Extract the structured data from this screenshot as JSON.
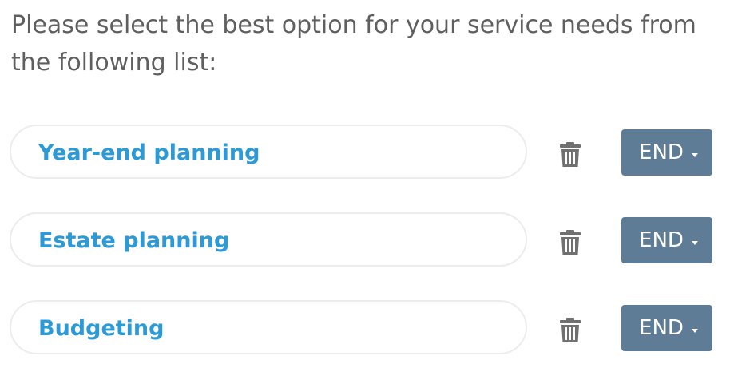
{
  "prompt": "Please select the best option for your service needs from the following list:",
  "options": [
    {
      "label": "Year-end planning",
      "action_label": "END"
    },
    {
      "label": "Estate planning",
      "action_label": "END"
    },
    {
      "label": "Budgeting",
      "action_label": "END"
    }
  ],
  "icons": {
    "delete": "trash-icon",
    "dropdown": "caret-down-icon"
  },
  "colors": {
    "prompt_text": "#5f5f5f",
    "option_text": "#2d9ad8",
    "pill_border": "#ececec",
    "button_bg": "#5e7c96",
    "trash": "#707070"
  }
}
